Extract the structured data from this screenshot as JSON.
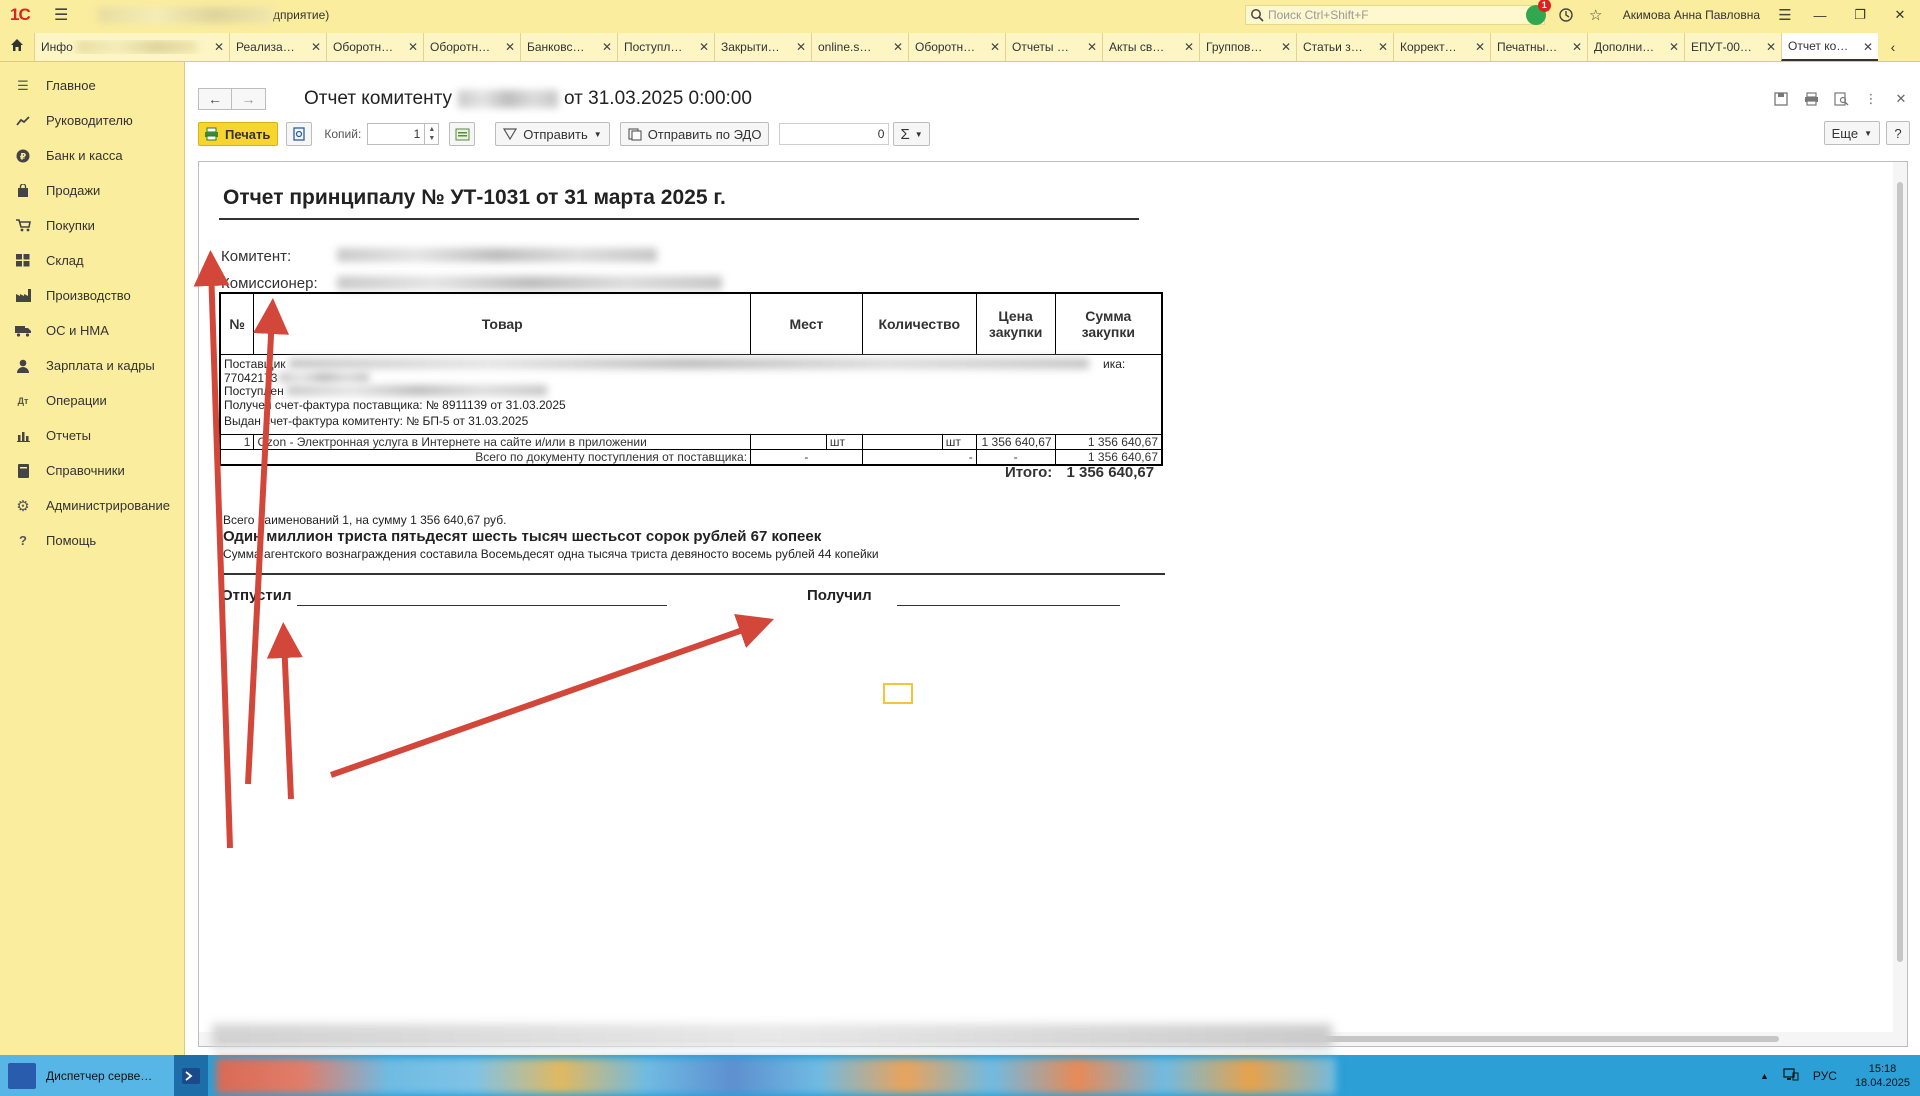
{
  "app": {
    "logo": "1С",
    "title_suffix": "дприятие)",
    "search_placeholder": "Поиск Ctrl+Shift+F",
    "notifications_count": "1",
    "user": "Акимова Анна Павловна",
    "colors": {
      "accent": "#fbed9e",
      "print_button": "#f7d52f",
      "arrow": "#d2473a",
      "taskbar": "#2b9fd6"
    }
  },
  "tabs": [
    {
      "label": "Инфо"
    },
    {
      "label": "Реализа…"
    },
    {
      "label": "Оборотн…"
    },
    {
      "label": "Оборотн…"
    },
    {
      "label": "Банковс…"
    },
    {
      "label": "Поступл…"
    },
    {
      "label": "Закрыти…"
    },
    {
      "label": "online.s…"
    },
    {
      "label": "Оборотн…"
    },
    {
      "label": "Отчеты …"
    },
    {
      "label": "Акты св…"
    },
    {
      "label": "Группов…"
    },
    {
      "label": "Статьи з…"
    },
    {
      "label": "Коррект…"
    },
    {
      "label": "Печатны…"
    },
    {
      "label": "Дополни…"
    },
    {
      "label": "ЕПУТ-00…"
    },
    {
      "label": "Отчет ко…"
    }
  ],
  "sidebar": {
    "items": [
      {
        "label": "Главное",
        "icon": "menu-icon"
      },
      {
        "label": "Руководителю",
        "icon": "trend-icon"
      },
      {
        "label": "Банк и касса",
        "icon": "ruble-icon"
      },
      {
        "label": "Продажи",
        "icon": "bag-icon"
      },
      {
        "label": "Покупки",
        "icon": "cart-icon"
      },
      {
        "label": "Склад",
        "icon": "warehouse-icon"
      },
      {
        "label": "Производство",
        "icon": "factory-icon"
      },
      {
        "label": "ОС и НМА",
        "icon": "truck-icon"
      },
      {
        "label": "Зарплата и кадры",
        "icon": "person-icon"
      },
      {
        "label": "Операции",
        "icon": "operations-icon"
      },
      {
        "label": "Отчеты",
        "icon": "chart-icon"
      },
      {
        "label": "Справочники",
        "icon": "book-icon"
      },
      {
        "label": "Администрирование",
        "icon": "gear-icon"
      },
      {
        "label": "Помощь",
        "icon": "help-icon"
      }
    ]
  },
  "document": {
    "title_prefix": "Отчет комитенту",
    "title_suffix": "от 31.03.2025 0:00:00",
    "toolbar": {
      "print_label": "Печать",
      "copies_label": "Копий:",
      "copies_value": "1",
      "send_label": "Отправить",
      "send_edo_label": "Отправить по ЭДО",
      "counter_value": "0",
      "sum_label": "Σ",
      "more_label": "Еще",
      "help_label": "?"
    }
  },
  "report": {
    "title": "Отчет принципалу № УТ-1031 от 31 марта 2025 г.",
    "komitent_label": "Комитент:",
    "komissioner_label": "Комиссионер:",
    "headers": {
      "num": "№",
      "goods": "Товар",
      "places": "Мест",
      "quantity": "Количество",
      "price": "Цена закупки",
      "sum": "Сумма закупки"
    },
    "supplier_lines": {
      "line1_prefix": "Поставщик",
      "line1_suffix": "ика:",
      "line2_prefix": "77042173",
      "line3_prefix": "Поступлен",
      "line4": "Получен счет-фактура поставщика: № 8911139 от 31.03.2025",
      "line5": "Выдан счет-фактура комитенту: № БП-5 от 31.03.2025"
    },
    "row": {
      "num": "1",
      "goods": "Ozon - Электронная услуга в Интернете на сайте и/или в приложении",
      "unit1": "шт",
      "unit2": "шт",
      "price": "1 356 640,67",
      "sum": "1 356 640,67"
    },
    "total_row": {
      "label": "Всего по документу поступления от поставщика:",
      "dash1": "-",
      "dash2": "-",
      "dash3": "-",
      "sum": "1 356 640,67"
    },
    "itogo_label": "Итого:",
    "itogo_value": "1 356 640,67",
    "summary_line1": "Всего наименований 1, на сумму 1 356 640,67 руб.",
    "summary_line2": "Один миллион триста пятьдесят шесть тысяч шестьсот сорок рублей 67 копеек",
    "summary_line3": "Сумма агентского вознаграждения составила Восемьдесят одна тысяча триста девяносто восемь рублей 44 копейки",
    "released_label": "Отпустил",
    "received_label": "Получил"
  },
  "taskbar": {
    "active_label": "Диспетчер серве…",
    "lang": "РУС",
    "time": "15:18",
    "date": "18.04.2025"
  }
}
